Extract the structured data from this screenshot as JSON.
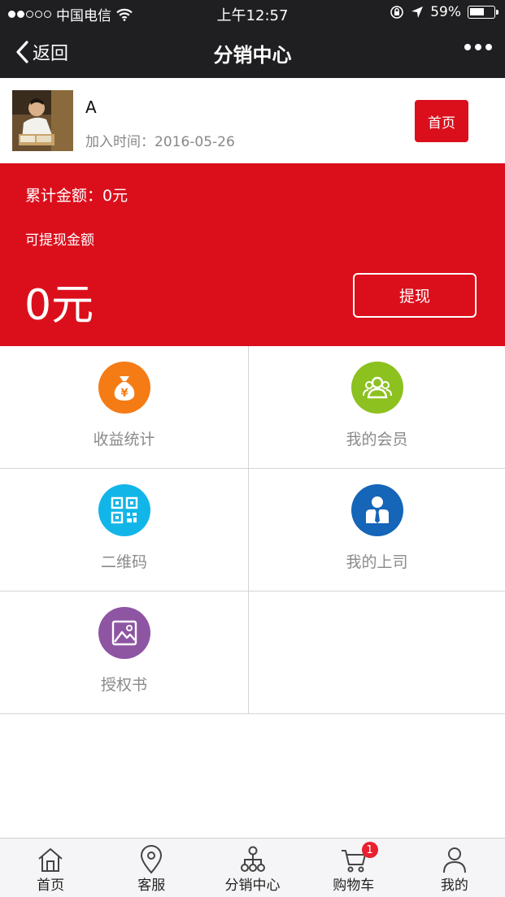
{
  "status_bar": {
    "carrier": "中国电信",
    "time": "上午12:57",
    "battery": "59%",
    "battery_level": 0.59
  },
  "nav": {
    "back_label": "返回",
    "title": "分销中心"
  },
  "profile": {
    "name": "A",
    "join_time": "加入时间：2016-05-26",
    "home_button": "首页"
  },
  "earnings": {
    "total": "累计金额：0元",
    "withdrawable_label": "可提现金额",
    "withdrawable_value": "0元",
    "withdraw_button": "提现"
  },
  "menu": [
    {
      "label": "收益统计",
      "icon": "money-bag-icon",
      "color": "#f57b15"
    },
    {
      "label": "我的会员",
      "icon": "members-icon",
      "color": "#8cc11f"
    },
    {
      "label": "二维码",
      "icon": "qr-code-icon",
      "color": "#12b5e8"
    },
    {
      "label": "我的上司",
      "icon": "superior-icon",
      "color": "#1565b8"
    },
    {
      "label": "授权书",
      "icon": "certificate-icon",
      "color": "#8e55a3"
    }
  ],
  "tabbar": {
    "items": [
      {
        "label": "首页",
        "icon": "home-icon"
      },
      {
        "label": "客服",
        "icon": "location-pin-icon"
      },
      {
        "label": "分销中心",
        "icon": "network-icon"
      },
      {
        "label": "购物车",
        "icon": "cart-icon",
        "badge": "1"
      },
      {
        "label": "我的",
        "icon": "user-icon"
      }
    ]
  },
  "colors": {
    "brand_red": "#db0f1c",
    "dark_bar": "#1f1f21"
  }
}
